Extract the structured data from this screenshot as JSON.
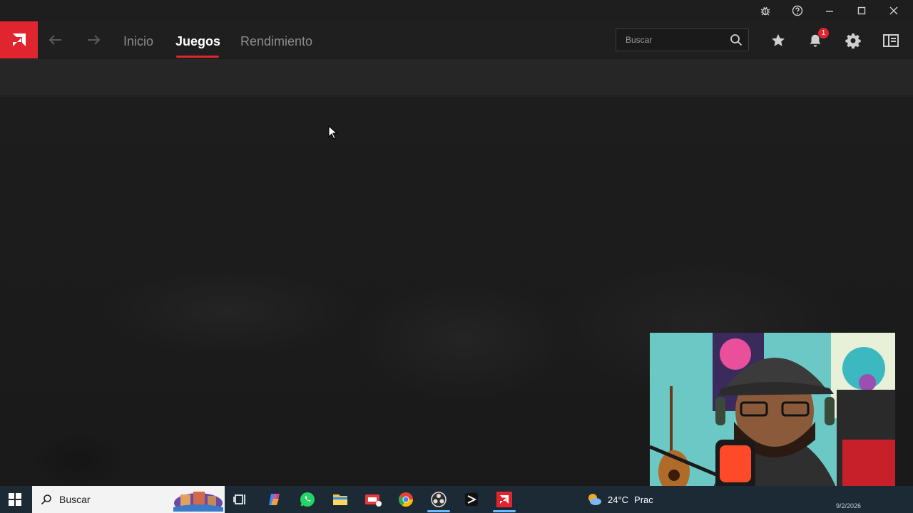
{
  "nav": {
    "tabs": [
      {
        "label": "Inicio",
        "active": false
      },
      {
        "label": "Juegos",
        "active": true
      },
      {
        "label": "Rendimiento",
        "active": false
      }
    ]
  },
  "search": {
    "placeholder": "Buscar"
  },
  "notifications": {
    "count": "1"
  },
  "colors": {
    "accent": "#e1252f",
    "background": "#232323"
  },
  "icons": [
    "bug-icon",
    "help-icon",
    "minimize-icon",
    "maximize-icon",
    "close-icon",
    "amd-logo",
    "back-arrow-icon",
    "forward-arrow-icon",
    "search-icon",
    "star-icon",
    "bell-icon",
    "gear-icon",
    "sidebar-icon"
  ],
  "taskbar": {
    "search_label": "Buscar",
    "weather": {
      "temp": "24°C",
      "desc": "Prac"
    },
    "date": "9/2/2026"
  }
}
